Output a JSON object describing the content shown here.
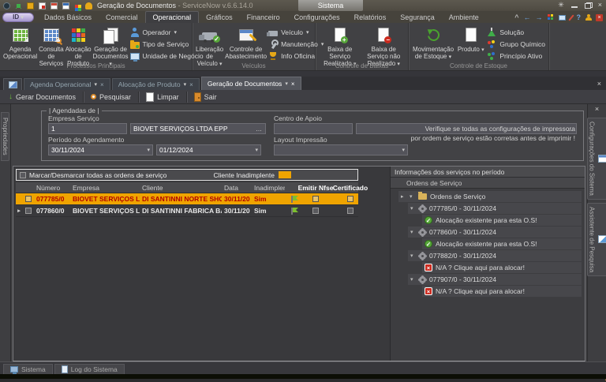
{
  "window": {
    "title": "Geração de Documentos",
    "subtitle": "- ServiceNow v.6.6.14.0",
    "context_tab": "Sistema"
  },
  "icons": {
    "dropdown": "▾",
    "expand": "▸",
    "collapse": "▾",
    "close": "×",
    "check": "✓",
    "chevron_up": "^",
    "arrow_left": "←",
    "arrow_right": "→",
    "question": "?",
    "down_arrow": "↓",
    "ellipsis": "…",
    "row_marker": "▸",
    "plus": "+",
    "minus": "−",
    "cross": "×"
  },
  "colors": {
    "accent": "#efa400",
    "alert_text": "#b00000",
    "ok_green": "#57a639",
    "error_red": "#cc2a1e"
  },
  "ribbon": {
    "app_button": "ID",
    "tabs": [
      "Dados Básicos",
      "Comercial",
      "Operacional",
      "Gráficos",
      "Financeiro",
      "Configurações",
      "Relatórios",
      "Segurança",
      "Ambiente"
    ],
    "active_tab": "Operacional",
    "groups": [
      {
        "label": "Processos Principais",
        "large": [
          {
            "label": "Agenda Operacional"
          },
          {
            "label": "Consulta de Serviços"
          },
          {
            "label": "Alocação de Produto"
          },
          {
            "label": "Geração de Documentos"
          }
        ],
        "small": [
          {
            "label": "Operador"
          },
          {
            "label": "Tipo de Serviço"
          },
          {
            "label": "Unidade de Negócio"
          }
        ]
      },
      {
        "label": "Veículos",
        "large": [
          {
            "label": "Liberação de Veículo"
          },
          {
            "label": "Controle de Abastecimento"
          }
        ],
        "small": [
          {
            "label": "Veículo"
          },
          {
            "label": "Manutenção"
          },
          {
            "label": "Info Oficina"
          }
        ]
      },
      {
        "label": "Controle de Baixas",
        "large": [
          {
            "label": "Baixa de Serviço Realizado"
          },
          {
            "label": "Baixa de Serviço não Realizado"
          }
        ],
        "small": []
      },
      {
        "label": "Controle de Estoque",
        "large": [
          {
            "label": "Movimentação de Estoque"
          },
          {
            "label": "Produto"
          }
        ],
        "small": [
          {
            "label": "Solução"
          },
          {
            "label": "Grupo Químico"
          },
          {
            "label": "Princípio Ativo"
          }
        ]
      }
    ]
  },
  "doc_tabs": [
    {
      "label": "Agenda Operacional",
      "active": false
    },
    {
      "label": "Alocação de Produto",
      "active": false
    },
    {
      "label": "Geração de Documentos",
      "active": true
    }
  ],
  "toolbar": [
    {
      "label": "Gerar Documentos"
    },
    {
      "label": "Pesquisar"
    },
    {
      "label": "Limpar"
    },
    {
      "label": "Sair"
    }
  ],
  "form": {
    "group_label": "| Agendadas de |",
    "empresa_servico": {
      "label": "Empresa Serviço",
      "code": "1",
      "name": "BIOVET SERVIÇOS LTDA EPP"
    },
    "centro_apoio": {
      "label": "Centro de Apoio",
      "code": "",
      "name": ""
    },
    "periodo": {
      "label": "Período do Agendamento",
      "from": "30/11/2024",
      "to": "01/12/2024"
    },
    "layout": {
      "label": "Layout Impressão",
      "value": ""
    },
    "note_line1": "Verifique se todas as configurações de impressora",
    "note_line2": "por ordem de serviço estão corretas antes de imprimir !"
  },
  "grid": {
    "select_all_label": "Marcar/Desmarcar todas as ordens de serviço",
    "inadimplente_label": "Cliente Inadimplente",
    "columns": [
      "Número",
      "Empresa",
      "Cliente",
      "Data",
      "Inadimplente",
      "Emitir Nfse",
      "Certificado"
    ],
    "rows": [
      {
        "numero": "077785/0",
        "empresa": "BIOVET  SERVIÇOS LTD",
        "cliente": "DI SANTINNI NORTE SHOPPIN",
        "data": "30/11/20",
        "inadimplente": "Sim",
        "selected": true
      },
      {
        "numero": "077860/0",
        "empresa": "BIOVET  SERVIÇOS LTD",
        "cliente": "DI SANTINNI FABRICA BANGU",
        "data": "30/11/20",
        "inadimplente": "Sim",
        "selected": false
      }
    ]
  },
  "info_panel": {
    "title": "Informações dos serviços no período",
    "column_header": "Ordens de Serviço",
    "root": "Ordens de Serviço",
    "items": [
      {
        "os": "077785/0 - 30/11/2024",
        "status": "ok",
        "message": "Alocação existente para esta O.S!"
      },
      {
        "os": "077860/0 - 30/11/2024",
        "status": "ok",
        "message": "Alocação existente para esta O.S!"
      },
      {
        "os": "077882/0 - 30/11/2024",
        "status": "na",
        "message": "N/A ? Clique aqui para alocar!"
      },
      {
        "os": "077907/0 - 30/11/2024",
        "status": "na",
        "message": "N/A ? Clique aqui para alocar!"
      }
    ]
  },
  "side_tabs": {
    "left": "Propriedades",
    "right": [
      "Configurações do Sistema",
      "Assistente de Pesquisa"
    ]
  },
  "statusbar": [
    {
      "label": "Sistema"
    },
    {
      "label": "Log do Sistema"
    }
  ]
}
